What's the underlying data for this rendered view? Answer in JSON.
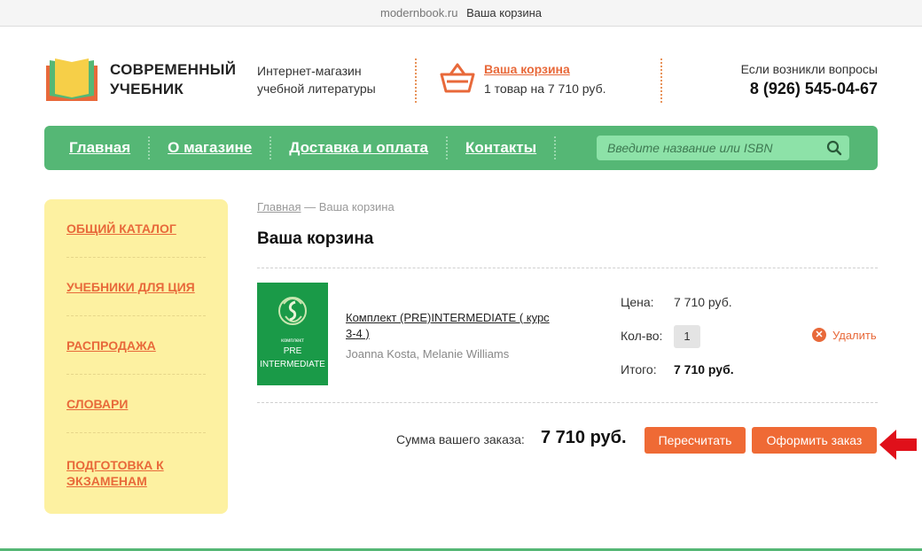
{
  "browser": {
    "domain": "modernbook.ru",
    "title": "Ваша корзина"
  },
  "header": {
    "logo_line1": "СОВРЕМЕННЫЙ",
    "logo_line2": "УЧЕБНИК",
    "tagline_line1": "Интернет-магазин",
    "tagline_line2": "учебной литературы",
    "cart_link": "Ваша корзина",
    "cart_summary": "1 товар на 7 710 руб.",
    "contact_question": "Если возникли вопросы",
    "phone": "8 (926) 545-04-67"
  },
  "nav": {
    "items": [
      {
        "label": "Главная"
      },
      {
        "label": "О магазине"
      },
      {
        "label": "Доставка и оплата"
      },
      {
        "label": "Контакты"
      }
    ],
    "search_placeholder": "Введите название или ISBN"
  },
  "sidebar": {
    "items": [
      {
        "label": "ОБЩИЙ КАТАЛОГ"
      },
      {
        "label": "УЧЕБНИКИ ДЛЯ ЦИЯ"
      },
      {
        "label": "РАСПРОДАЖА"
      },
      {
        "label": "СЛОВАРИ"
      },
      {
        "label": "ПОДГОТОВКА К ЭКЗАМЕНАМ"
      }
    ]
  },
  "breadcrumb": {
    "home": "Главная",
    "separator": " — ",
    "current": "Ваша корзина"
  },
  "page_title": "Ваша корзина",
  "cart": {
    "item": {
      "cover_kit": "комплект",
      "cover_level_line1": "PRE",
      "cover_level_line2": "INTERMEDIATE",
      "title": "Комплект (PRE)INTERMEDIATE ( курс 3-4 )",
      "authors": "Joanna Kosta, Melanie Williams",
      "price_label": "Цена:",
      "price": "7 710 руб.",
      "qty_label": "Кол-во:",
      "qty": "1",
      "total_label": "Итого:",
      "total": "7 710 руб.",
      "remove_label": "Удалить"
    },
    "sum_label": "Сумма вашего заказа:",
    "sum_value": "7 710 руб.",
    "recalc_label": "Пересчитать",
    "order_label": "Оформить заказ"
  },
  "colors": {
    "accent": "#ef6a35",
    "nav_green": "#55b775",
    "sidebar_bg": "#fdf1a1",
    "arrow_red": "#e0101a"
  }
}
